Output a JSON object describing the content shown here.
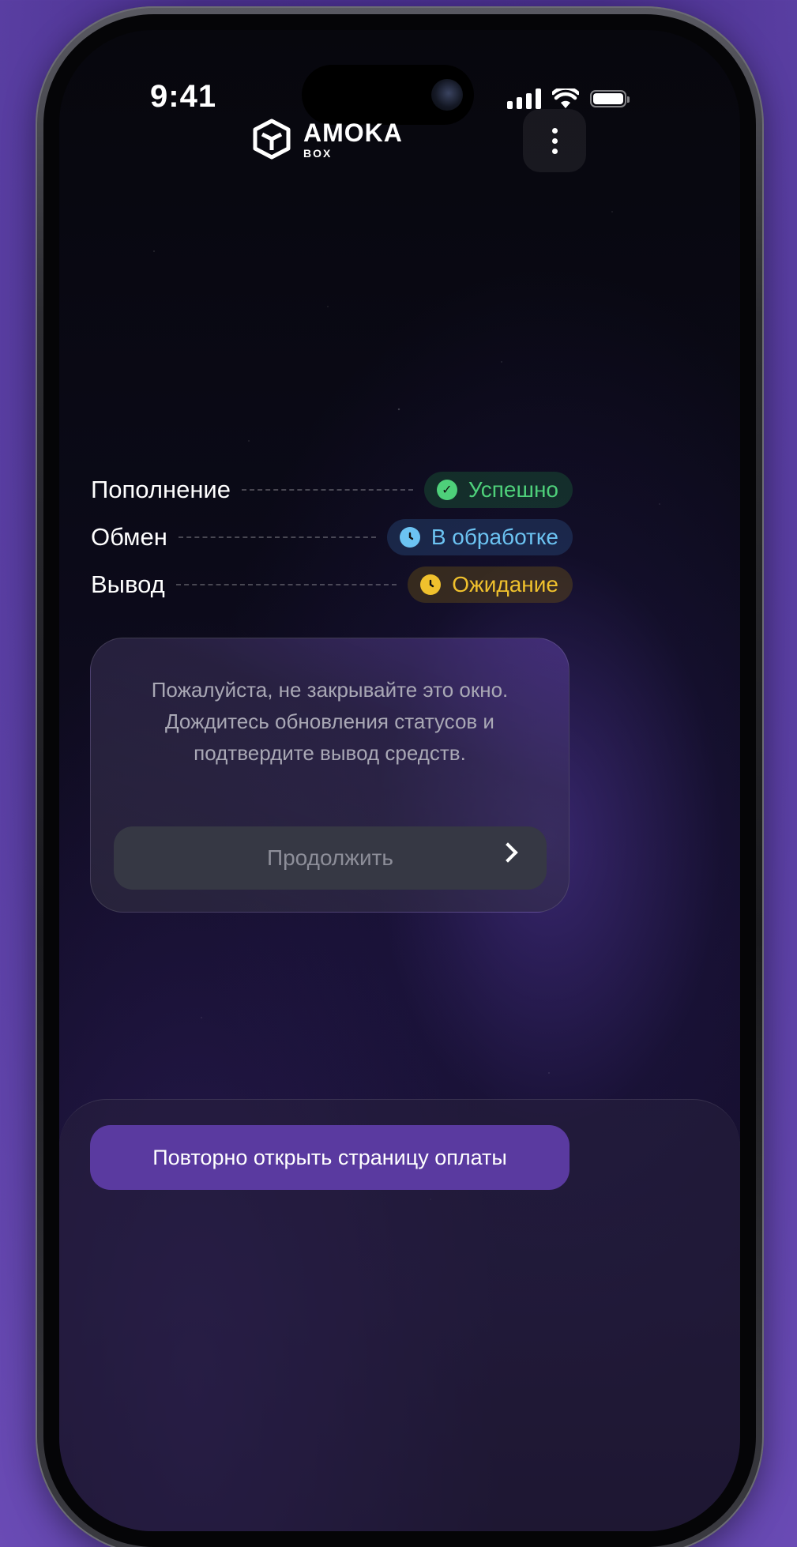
{
  "status_bar": {
    "time": "9:41"
  },
  "header": {
    "logo_title": "AMOKA",
    "logo_sub": "BOX"
  },
  "steps": [
    {
      "label": "Пополнение",
      "status": "Успешно",
      "state": "success",
      "color": "#4ed07a"
    },
    {
      "label": "Обмен",
      "status": "В обработке",
      "state": "processing",
      "color": "#6cc3f2"
    },
    {
      "label": "Вывод",
      "status": "Ожидание",
      "state": "waiting",
      "color": "#f0c12d"
    }
  ],
  "info_card": {
    "message": "Пожалуйста, не закрывайте это окно. Дождитесь обновления статусов и подтвердите вывод средств.",
    "continue_label": "Продолжить"
  },
  "bottom": {
    "reopen_label": "Повторно открыть страницу оплаты"
  },
  "colors": {
    "accent": "#5a3aa0",
    "background": "#0b0a18"
  }
}
